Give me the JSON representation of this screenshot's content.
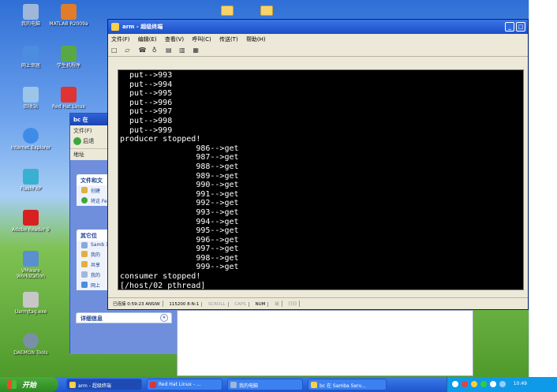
{
  "desktop": {
    "icons": [
      {
        "label": "我的电脑",
        "color": "#9fb7d9"
      },
      {
        "label": "MATLAB R2009a",
        "color": "#e07c2a"
      },
      {
        "label": "网上邻居",
        "color": "#4c8de0"
      },
      {
        "label": "学生机程序",
        "color": "#59a845"
      },
      {
        "label": "回收站",
        "color": "#9bc6ea"
      },
      {
        "label": "Red Hat Linux",
        "color": "#e03333"
      },
      {
        "label": "Internet Explorer",
        "color": "#3f8ce8"
      },
      {
        "label": "FlashFXP",
        "color": "#3ab0d0"
      },
      {
        "label": "Adobe Reader 9",
        "color": "#d92020"
      },
      {
        "label": "VMware Workstation",
        "color": "#5a8fd0"
      },
      {
        "label": "UarmJtag.exe",
        "color": "#c7c7c7"
      },
      {
        "label": "DAEMON Tools",
        "color": "#7a8fa8"
      }
    ]
  },
  "explorer": {
    "title": "bc 在",
    "menu": "文件(F)",
    "back_label": "后退",
    "address_label": "地址",
    "file_tasks_title": "文件和文",
    "file_tasks": [
      "创建",
      "将这 Feb"
    ],
    "other_places_title": "其它位",
    "other_places": [
      "Samb 192",
      "我的",
      "共享",
      "我的",
      "网上"
    ],
    "details_title": "详细信息",
    "details_chevron": "»"
  },
  "terminal": {
    "title": "arm - 超级终端",
    "menu": [
      "文件(F)",
      "编辑(E)",
      "查看(V)",
      "呼叫(C)",
      "传送(T)",
      "帮助(H)"
    ],
    "toolbar_icons": [
      "new-icon",
      "open-icon",
      "disconnect-icon",
      "properties-icon",
      "send-icon",
      "receive-icon",
      "settings-icon"
    ],
    "lines": [
      "  put-->993",
      "  put-->994",
      "  put-->995",
      "  put-->996",
      "  put-->997",
      "  put-->998",
      "  put-->999",
      "producer stopped!",
      "                986-->get",
      "                987-->get",
      "                988-->get",
      "                989-->get",
      "                990-->get",
      "                991-->get",
      "                992-->get",
      "                993-->get",
      "                994-->get",
      "                995-->get",
      "                996-->get",
      "                997-->get",
      "                998-->get",
      "                999-->get",
      "consumer stopped!",
      "[/host/02_pthread]"
    ],
    "status": {
      "connection": "已连接 0:59:23 ANSIW",
      "baud": "115200 8-N-1",
      "scroll": "SCROLL",
      "caps": "CAPS",
      "num": "NUM",
      "capture": "捕",
      "print": "打印"
    }
  },
  "taskbar": {
    "start_label": "开始",
    "buttons": [
      {
        "label": "arm - 超级终端",
        "active": true
      },
      {
        "label": "Red Hat Linux - ...",
        "active": false
      },
      {
        "label": "我的电脑",
        "active": false
      },
      {
        "label": "bc 在 Samba Serv...",
        "active": false
      }
    ],
    "clock": "10:49"
  }
}
